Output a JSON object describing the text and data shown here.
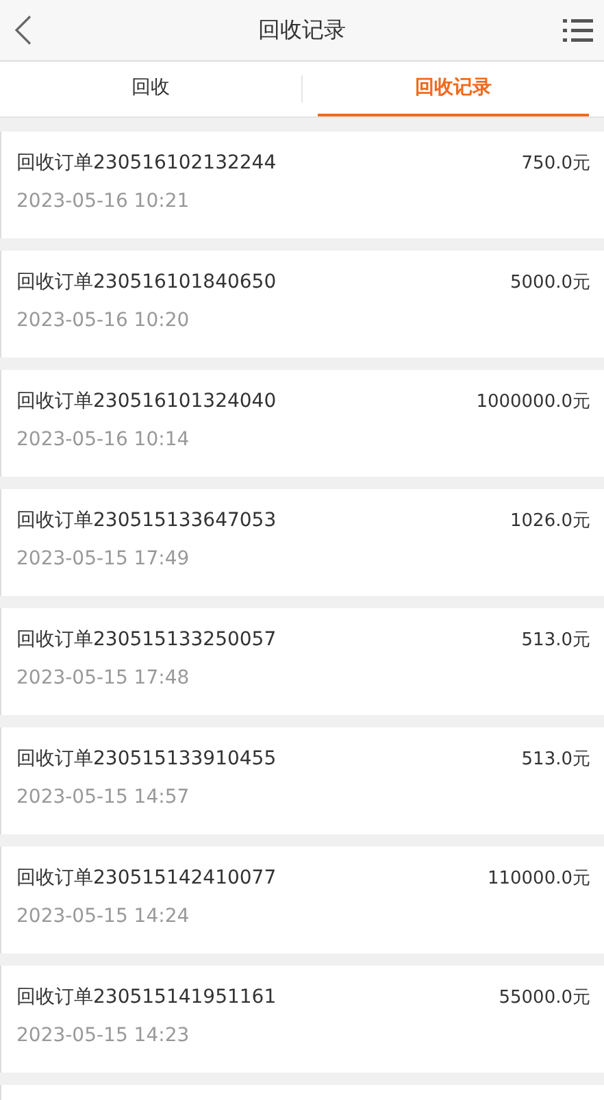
{
  "header": {
    "title": "回收记录"
  },
  "tabs": [
    {
      "label": "回收",
      "selected": false
    },
    {
      "label": "回收记录",
      "selected": true
    }
  ],
  "records": [
    {
      "title": "回收订单230516102132244",
      "amount": "750.0元",
      "time": "2023-05-16 10:21"
    },
    {
      "title": "回收订单230516101840650",
      "amount": "5000.0元",
      "time": "2023-05-16 10:20"
    },
    {
      "title": "回收订单230516101324040",
      "amount": "1000000.0元",
      "time": "2023-05-16 10:14"
    },
    {
      "title": "回收订单230515133647053",
      "amount": "1026.0元",
      "time": "2023-05-15 17:49"
    },
    {
      "title": "回收订单230515133250057",
      "amount": "513.0元",
      "time": "2023-05-15 17:48"
    },
    {
      "title": "回收订单230515133910455",
      "amount": "513.0元",
      "time": "2023-05-15 14:57"
    },
    {
      "title": "回收订单230515142410077",
      "amount": "110000.0元",
      "time": "2023-05-15 14:24"
    },
    {
      "title": "回收订单230515141951161",
      "amount": "55000.0元",
      "time": "2023-05-15 14:23"
    }
  ]
}
